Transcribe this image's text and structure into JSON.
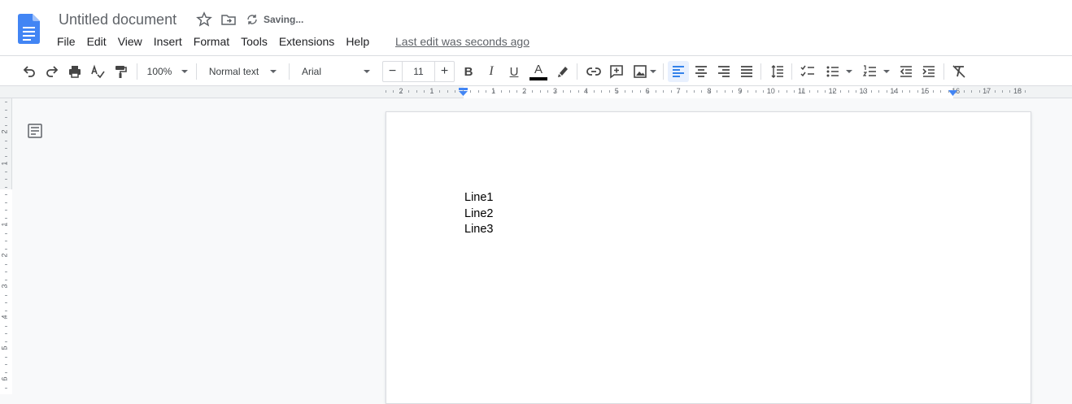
{
  "app": {
    "doc_title": "Untitled document",
    "save_status": "Saving...",
    "last_edit": "Last edit was seconds ago",
    "brand_color": "#4285f4"
  },
  "menu": [
    "File",
    "Edit",
    "View",
    "Insert",
    "Format",
    "Tools",
    "Extensions",
    "Help"
  ],
  "toolbar": {
    "zoom": "100%",
    "style": "Normal text",
    "font": "Arial",
    "font_size": "11",
    "minus": "−",
    "plus": "+",
    "bold": "B",
    "italic": "I",
    "underline": "U",
    "text_color_letter": "A"
  },
  "ruler": {
    "labels": [
      "2",
      "1",
      "1",
      "2",
      "3",
      "4",
      "5",
      "6",
      "7",
      "8",
      "9",
      "10",
      "11",
      "12",
      "13",
      "14",
      "15",
      "16",
      "17",
      "18"
    ]
  },
  "vruler": {
    "labels": [
      "2",
      "1",
      "1",
      "2",
      "3",
      "4",
      "5",
      "6"
    ]
  },
  "document": {
    "lines": [
      "Line1",
      "Line2",
      "Line3"
    ]
  }
}
